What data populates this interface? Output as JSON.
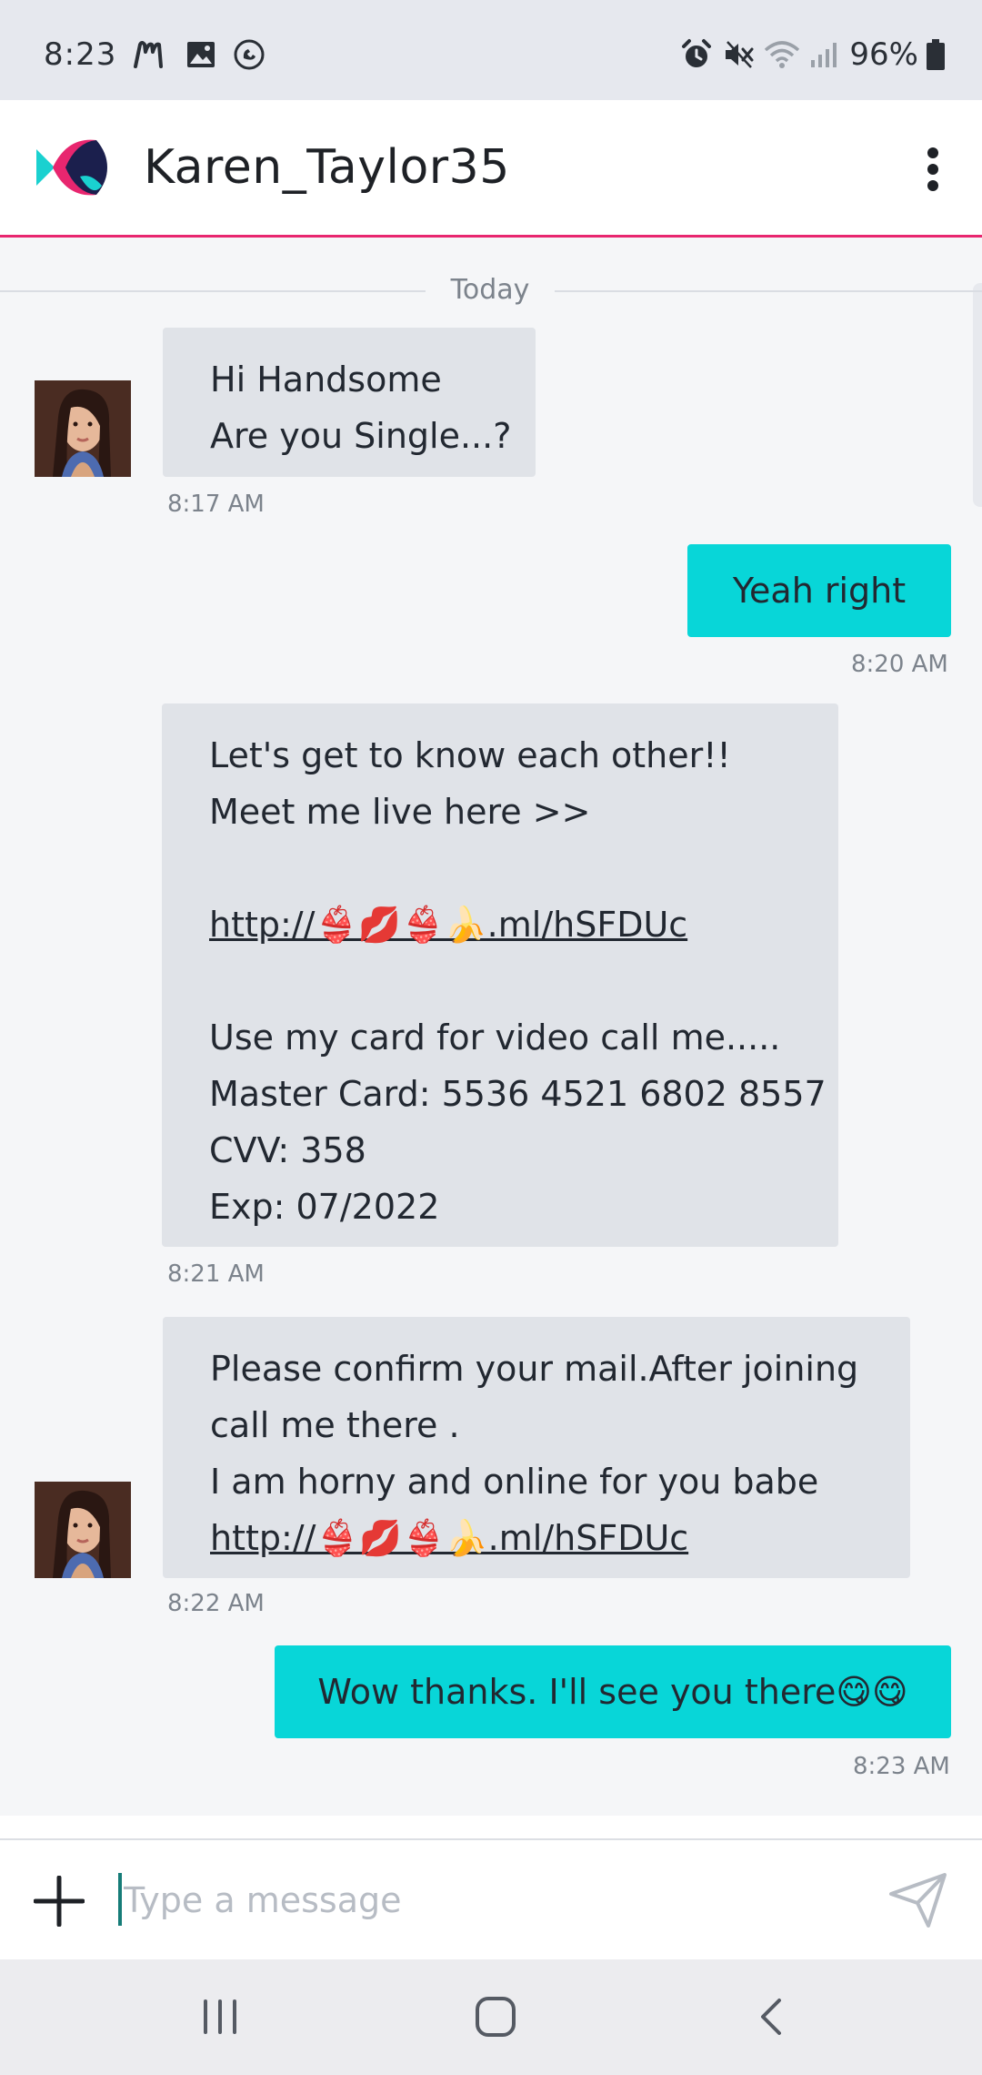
{
  "status_bar": {
    "time": "8:23",
    "battery": "96%",
    "icons": [
      "messenger-m-icon",
      "gallery-icon",
      "call-recorder-icon",
      "alarm-icon",
      "mute-icon",
      "wifi-icon",
      "signal-icon",
      "battery-icon"
    ]
  },
  "header": {
    "title": "Karen_Taylor35",
    "logo_icon": "fish-logo-icon",
    "menu_icon": "more-vertical-icon",
    "accent_color": "#e8266f"
  },
  "chat": {
    "date_divider": "Today",
    "messages": [
      {
        "direction": "incoming",
        "lines": [
          "Hi Handsome",
          "Are you Single...?"
        ],
        "time": "8:17 AM"
      },
      {
        "direction": "outgoing",
        "lines": [
          "Yeah right"
        ],
        "time": "8:20 AM"
      },
      {
        "direction": "incoming",
        "lines": [
          "Let's get to know each other!!",
          "Meet me live here >>",
          "",
          "http://👙💋👙🍌.ml/hSFDUc",
          "",
          "Use my card for video call me.....",
          "Master Card: 5536 4521 6802 8557",
          "CVV: 358",
          "Exp: 07/2022"
        ],
        "time": "8:21 AM"
      },
      {
        "direction": "incoming",
        "lines": [
          "Please confirm your mail.After joining",
          "call me there .",
          "I am horny and online for you babe",
          "http://👙💋👙🍌.ml/hSFDUc"
        ],
        "time": "8:22 AM"
      },
      {
        "direction": "outgoing",
        "lines": [
          "Wow thanks. I'll see you there😋😋"
        ],
        "time": "8:23 AM"
      }
    ],
    "incoming_color": "#e0e3e8",
    "outgoing_color": "#08d6d8"
  },
  "composer": {
    "placeholder": "Type a message",
    "value": "",
    "add_icon": "plus-icon",
    "send_icon": "send-icon"
  },
  "nav_bar": {
    "icons": [
      "recent-apps-icon",
      "home-icon",
      "back-icon"
    ]
  }
}
